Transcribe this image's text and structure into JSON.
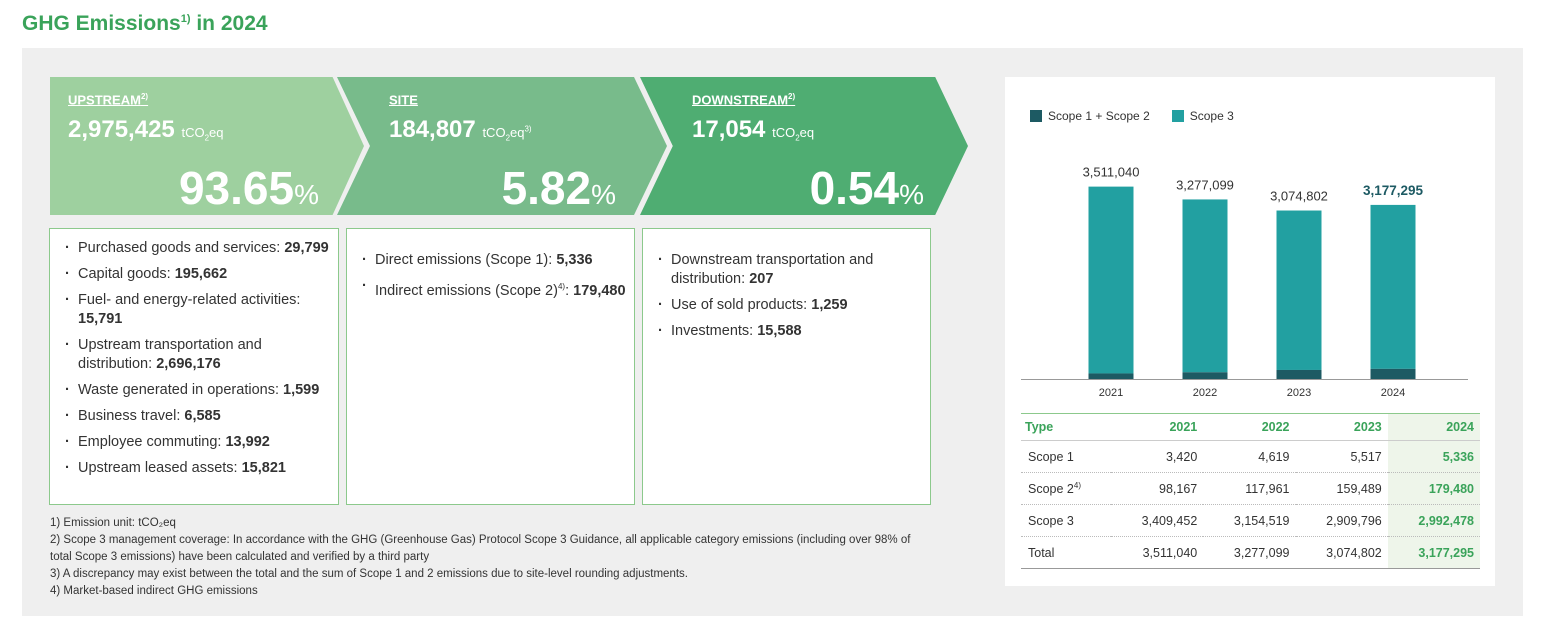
{
  "title": {
    "text": "GHG Emissions",
    "sup": "1)",
    "suffix": " in 2024"
  },
  "upstream": {
    "label": "UPSTREAM",
    "sup": "2)",
    "value": "2,975,425",
    "unit_pre": "tCO",
    "unit_sub": "2",
    "unit_post": "eq",
    "unit_sup": "",
    "pct": "93.65",
    "pct_sym": "%"
  },
  "site": {
    "label": "SITE",
    "sup": "",
    "value": "184,807",
    "unit_pre": "tCO",
    "unit_sub": "2",
    "unit_post": "eq",
    "unit_sup": "3)",
    "pct": "5.82",
    "pct_sym": "%"
  },
  "downstream": {
    "label": "DOWNSTREAM",
    "sup": "2)",
    "value": "17,054",
    "unit_pre": "tCO",
    "unit_sub": "2",
    "unit_post": "eq",
    "unit_sup": "",
    "pct": "0.54",
    "pct_sym": "%"
  },
  "upstream_items": [
    {
      "label": "Purchased goods and services: ",
      "sup": "",
      "value": "29,799"
    },
    {
      "label": "Capital goods: ",
      "sup": "",
      "value": "195,662"
    },
    {
      "label": "Fuel- and energy-related activities: ",
      "sup": "",
      "value": "15,791"
    },
    {
      "label": "Upstream transportation and distribution: ",
      "sup": "",
      "value": "2,696,176"
    },
    {
      "label": "Waste generated in operations: ",
      "sup": "",
      "value": "1,599"
    },
    {
      "label": "Business travel: ",
      "sup": "",
      "value": "6,585"
    },
    {
      "label": "Employee commuting: ",
      "sup": "",
      "value": "13,992"
    },
    {
      "label": "Upstream leased assets: ",
      "sup": "",
      "value": "15,821"
    }
  ],
  "site_items": [
    {
      "label": "Direct emissions (Scope 1): ",
      "sup": "",
      "value": "5,336"
    },
    {
      "label": "Indirect emissions (Scope 2)",
      "sup": "4)",
      "value": "179,480"
    }
  ],
  "downstream_items": [
    {
      "label": "Downstream transportation and distribution: ",
      "sup": "",
      "value": "207"
    },
    {
      "label": "Use of sold products: ",
      "sup": "",
      "value": "1,259"
    },
    {
      "label": "Investments: ",
      "sup": "",
      "value": "15,588"
    }
  ],
  "notes": [
    "1) Emission unit: tCO₂eq",
    "2) Scope 3 management coverage: In accordance with the GHG (Greenhouse Gas) Protocol Scope 3 Guidance, all applicable category emissions (including over 98% of total Scope 3 emissions) have been calculated and verified by a third party",
    "3) A discrepancy may exist between the total and the sum of Scope 1 and 2 emissions due to site-level rounding adjustments.",
    "4) Market-based indirect GHG emissions"
  ],
  "colors": {
    "scope12": "#1d5a63",
    "scope3": "#22a0a1",
    "accent": "#3aa35a"
  },
  "chart_data": {
    "type": "bar",
    "stacked": true,
    "categories": [
      "2021",
      "2022",
      "2023",
      "2024"
    ],
    "series": [
      {
        "name": "Scope 1 + Scope 2",
        "values": [
          101587,
          122580,
          165006,
          184816
        ]
      },
      {
        "name": "Scope 3",
        "values": [
          3409452,
          3154519,
          2909796,
          2992478
        ]
      }
    ],
    "totals": [
      "3,511,040",
      "3,277,099",
      "3,074,802",
      "3,177,295"
    ],
    "total_values": [
      3511040,
      3277099,
      3074802,
      3177295
    ],
    "legend_position": "top-left",
    "ylim": [
      0,
      3650000
    ]
  },
  "table": {
    "headers": [
      "Type",
      "2021",
      "2022",
      "2023",
      "2024"
    ],
    "rows": [
      {
        "label": "Scope 1",
        "sup": "",
        "values": [
          "3,420",
          "4,619",
          "5,517",
          "5,336"
        ]
      },
      {
        "label": "Scope 2",
        "sup": "4)",
        "values": [
          "98,167",
          "117,961",
          "159,489",
          "179,480"
        ]
      },
      {
        "label": "Scope 3",
        "sup": "",
        "values": [
          "3,409,452",
          "3,154,519",
          "2,909,796",
          "2,992,478"
        ]
      },
      {
        "label": "Total",
        "sup": "",
        "values": [
          "3,511,040",
          "3,277,099",
          "3,074,802",
          "3,177,295"
        ]
      }
    ]
  }
}
